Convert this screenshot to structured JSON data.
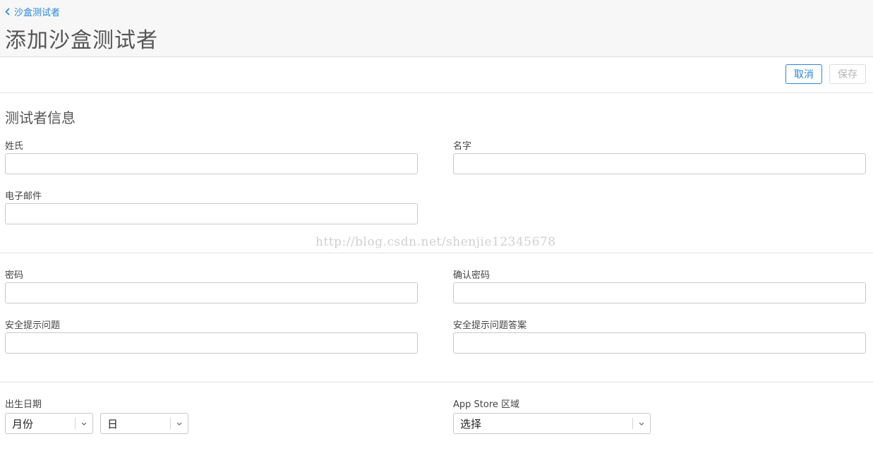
{
  "header": {
    "back_link": "沙盒测试者",
    "page_title": "添加沙盒测试者"
  },
  "toolbar": {
    "cancel_label": "取消",
    "save_label": "保存"
  },
  "tester_info": {
    "section_title": "测试者信息",
    "last_name_label": "姓氏",
    "first_name_label": "名字",
    "email_label": "电子邮件"
  },
  "security": {
    "password_label": "密码",
    "confirm_password_label": "确认密码",
    "question_label": "安全提示问题",
    "answer_label": "安全提示问题答案"
  },
  "other": {
    "birthday_label": "出生日期",
    "month_value": "月份",
    "day_value": "日",
    "region_label": "App Store 区域",
    "region_value": "选择"
  },
  "watermark": "http://blog.csdn.net/shenjie12345678",
  "colors": {
    "accent": "#2a86d8",
    "disabled": "#b6b6b6",
    "header_bg": "#f7f7f7"
  }
}
